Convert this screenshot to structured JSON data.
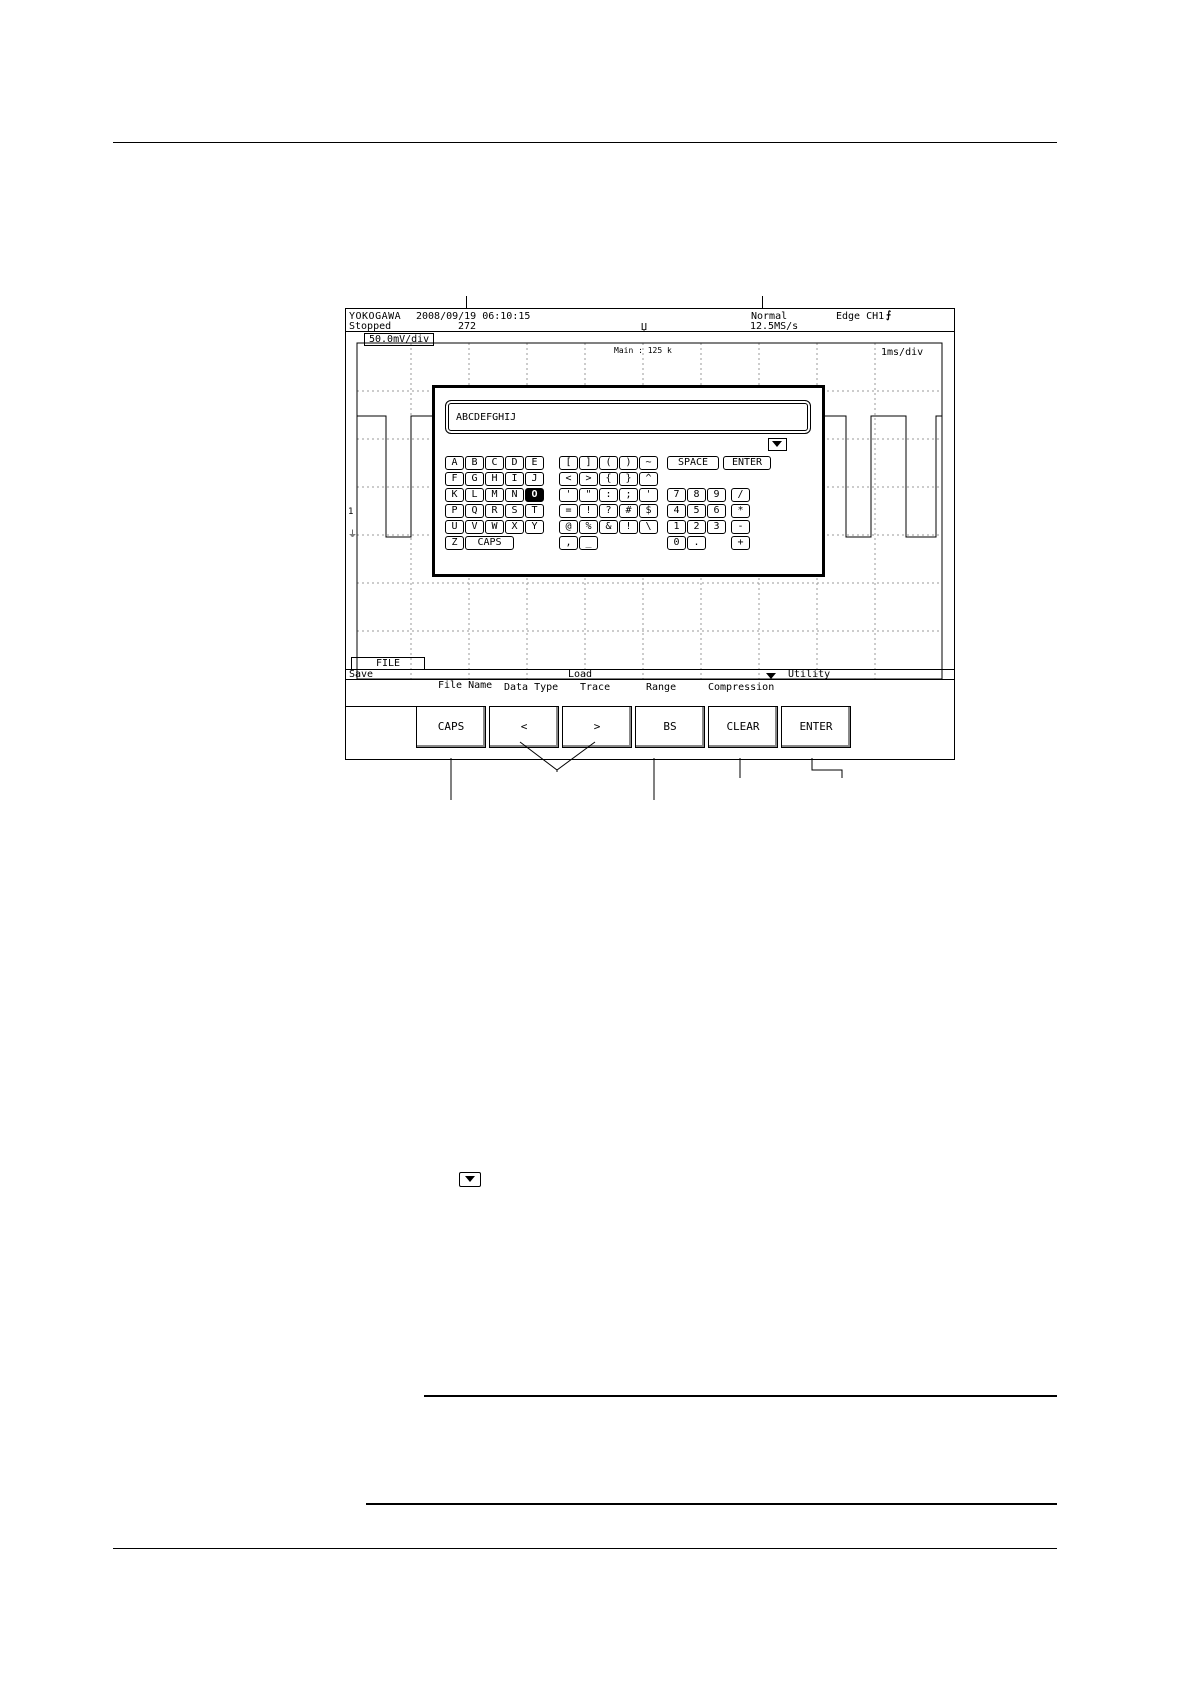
{
  "screen": {
    "header": {
      "brand": "YOKOGAWA",
      "datetime": "2008/09/19 06:10:15",
      "status": "Stopped",
      "record_count": "272",
      "trigger_mode": "Normal",
      "trigger_source": "Edge CH1",
      "sample_rate": "12.5MS/s",
      "channel_scale": "50.0mV/div",
      "main_points": "Main : 125 k",
      "time_div": "1ms/div"
    },
    "dialog": {
      "file_name_value": "ABCDEFGHIJ",
      "keys": {
        "row1": [
          "A",
          "B",
          "C",
          "D",
          "E",
          "[",
          "]",
          "(",
          ")",
          "~",
          "SPACE",
          "ENTER"
        ],
        "row2": [
          "F",
          "G",
          "H",
          "I",
          "J",
          "<",
          ">",
          "{",
          "}",
          "^"
        ],
        "row3": [
          "K",
          "L",
          "M",
          "N",
          "O",
          "'",
          "\"",
          ":",
          ";",
          "'",
          "7",
          "8",
          "9",
          "/"
        ],
        "row4": [
          "P",
          "Q",
          "R",
          "S",
          "T",
          "=",
          "!",
          "?",
          "#",
          "$",
          "4",
          "5",
          "6",
          "*"
        ],
        "row5": [
          "U",
          "V",
          "W",
          "X",
          "Y",
          "@",
          "%",
          "&",
          "!",
          "\\",
          "1",
          "2",
          "3",
          "-"
        ],
        "row6": [
          "Z",
          "CAPS",
          ",",
          "_",
          "0",
          ".",
          "+"
        ]
      }
    },
    "menu": {
      "file_tab": "FILE",
      "save_label": "Save",
      "load_label": "Load",
      "utility_label": "Utility",
      "underlying_labels": [
        "File Name",
        "Data Type",
        "Trace",
        "Range",
        "Compression"
      ]
    },
    "softkeys": [
      "CAPS",
      "<",
      ">",
      "BS",
      "CLEAR",
      "ENTER"
    ]
  },
  "icons": {
    "dropdown": "triangle-down-icon",
    "trigger_edge": "rising-edge-icon"
  }
}
